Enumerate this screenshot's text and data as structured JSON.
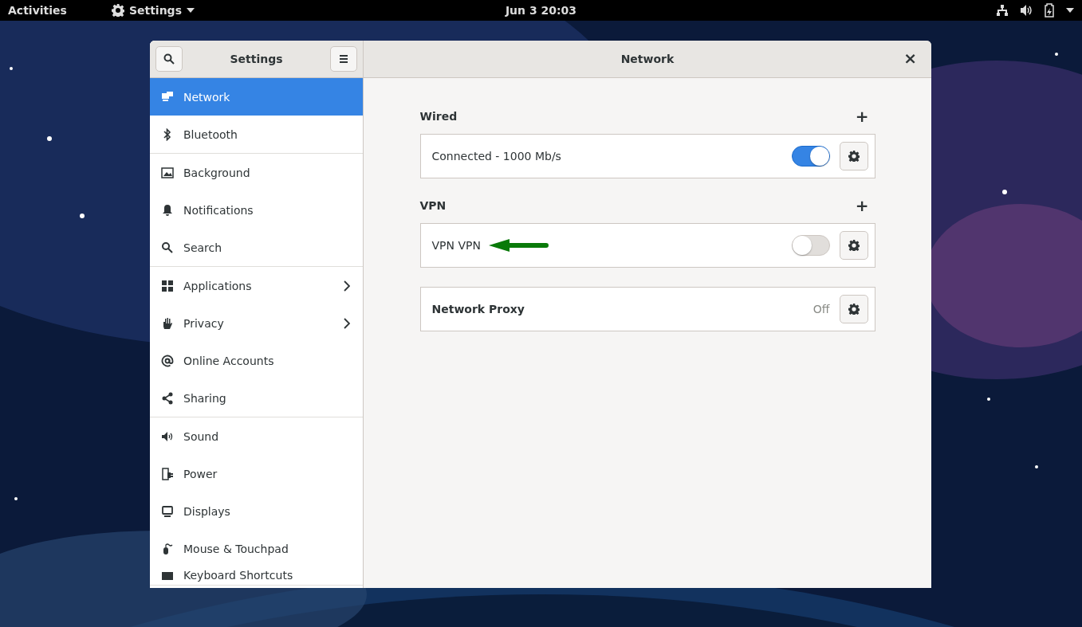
{
  "top_bar": {
    "activities": "Activities",
    "app_menu": "Settings",
    "clock": "Jun 3  20:03"
  },
  "window": {
    "sidebar_title": "Settings",
    "title": "Network",
    "close": "×"
  },
  "sidebar": {
    "groups": [
      [
        {
          "label": "Network",
          "selected": true,
          "submenu": false
        },
        {
          "label": "Bluetooth",
          "selected": false,
          "submenu": false
        }
      ],
      [
        {
          "label": "Background",
          "selected": false,
          "submenu": false
        },
        {
          "label": "Notifications",
          "selected": false,
          "submenu": false
        },
        {
          "label": "Search",
          "selected": false,
          "submenu": false
        }
      ],
      [
        {
          "label": "Applications",
          "selected": false,
          "submenu": true
        },
        {
          "label": "Privacy",
          "selected": false,
          "submenu": true
        },
        {
          "label": "Online Accounts",
          "selected": false,
          "submenu": false
        },
        {
          "label": "Sharing",
          "selected": false,
          "submenu": false
        }
      ],
      [
        {
          "label": "Sound",
          "selected": false,
          "submenu": false
        },
        {
          "label": "Power",
          "selected": false,
          "submenu": false
        },
        {
          "label": "Displays",
          "selected": false,
          "submenu": false
        },
        {
          "label": "Mouse & Touchpad",
          "selected": false,
          "submenu": false
        },
        {
          "label": "Keyboard Shortcuts",
          "selected": false,
          "submenu": false
        }
      ]
    ]
  },
  "sections": [
    {
      "heading": "Wired",
      "add": "+",
      "rows": [
        {
          "kind": "toggle",
          "label": "Connected - 1000 Mb/s",
          "on": true,
          "annotated": false
        }
      ]
    },
    {
      "heading": "VPN",
      "add": "+",
      "rows": [
        {
          "kind": "toggle",
          "label": "VPN VPN",
          "on": false,
          "annotated": true
        }
      ]
    },
    {
      "rows": [
        {
          "kind": "status",
          "label": "Network Proxy",
          "value": "Off"
        }
      ]
    }
  ]
}
